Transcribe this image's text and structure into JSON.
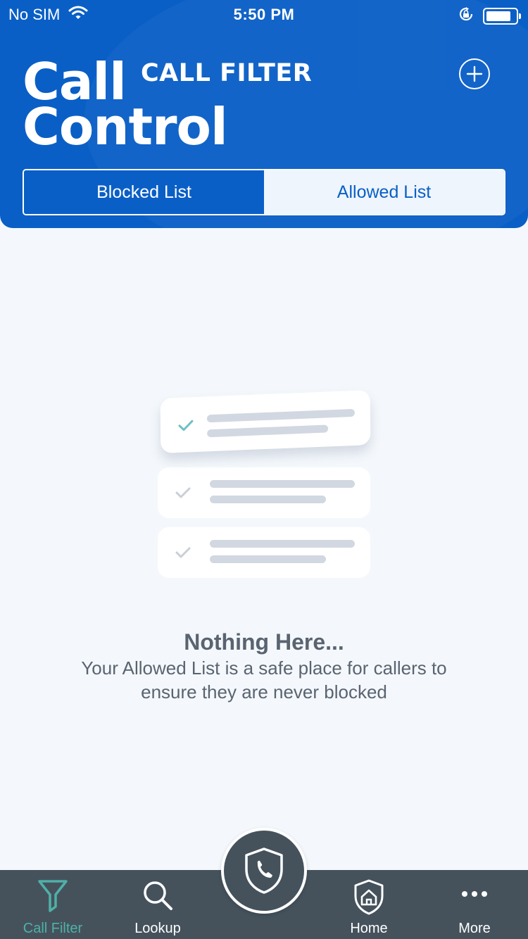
{
  "status_bar": {
    "carrier": "No SIM",
    "time": "5:50 PM",
    "wifi_icon": "wifi-icon",
    "lock_icon": "rotation-lock-icon",
    "battery_icon": "battery-icon"
  },
  "header": {
    "logo_line1": "Call",
    "logo_line2": "Control",
    "title": "CALL FILTER",
    "add_icon": "plus-circle-icon"
  },
  "tabs": {
    "blocked_label": "Blocked List",
    "allowed_label": "Allowed List",
    "selected": "Allowed List"
  },
  "empty_state": {
    "title": "Nothing Here...",
    "description": "Your Allowed List is a safe place for callers to ensure they are never blocked"
  },
  "tab_bar": {
    "items": [
      {
        "label": "Call Filter",
        "icon": "filter-icon",
        "active": true
      },
      {
        "label": "Lookup",
        "icon": "search-icon",
        "active": false
      },
      {
        "label": "Home",
        "icon": "home-shield-icon",
        "active": false
      },
      {
        "label": "More",
        "icon": "more-dots-icon",
        "active": false
      }
    ],
    "center_button_icon": "shield-phone-icon"
  },
  "colors": {
    "brand_blue": "#0a5fc6",
    "tab_bar_bg": "#45525c",
    "active_tab": "#4fb0a8",
    "check_teal": "#6fc0c4"
  }
}
